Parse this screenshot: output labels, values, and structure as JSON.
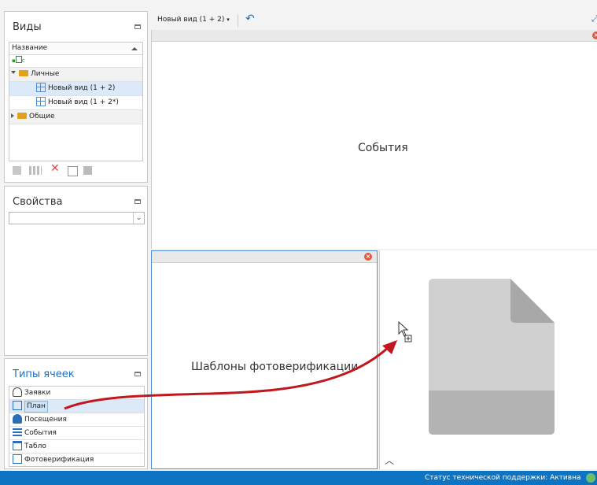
{
  "views_panel": {
    "title": "Виды",
    "column_header": "Название",
    "filter_icon_label": "A",
    "groups": [
      {
        "label": "Личные",
        "expanded": true,
        "items": [
          {
            "label": "Новый вид (1 + 2)",
            "selected": true
          },
          {
            "label": "Новый вид (1 + 2*)",
            "selected": false
          }
        ]
      },
      {
        "label": "Общие",
        "expanded": false,
        "items": []
      }
    ]
  },
  "properties_panel": {
    "title": "Свойства",
    "select_value": ""
  },
  "cell_types_panel": {
    "title": "Типы ячеек",
    "items": [
      {
        "label": "Заявки",
        "icon": "person-icon"
      },
      {
        "label": "План",
        "icon": "plan-icon",
        "highlighted": true
      },
      {
        "label": "Посещения",
        "icon": "visitor-icon"
      },
      {
        "label": "События",
        "icon": "list-lines-icon"
      },
      {
        "label": "Табло",
        "icon": "window-icon"
      },
      {
        "label": "Фотоверификация",
        "icon": "id-card-icon"
      }
    ]
  },
  "toolbar": {
    "view_selector": "Новый вид (1 + 2)",
    "undo_icon": "undo-icon",
    "fullscreen_icon": "expand-icon"
  },
  "panes": {
    "events_label": "События",
    "photo_templates_label": "Шаблоны фотоверификации",
    "preview_icon": "document-placeholder-icon"
  },
  "status": {
    "support_status": "Статус технической поддержки: Активна",
    "status_color": "#6bbf6b"
  },
  "colors": {
    "accent": "#1e6fc0",
    "status_bar": "#0d74c3",
    "drag_arrow": "#c0181e",
    "folder": "#e0a21c"
  }
}
